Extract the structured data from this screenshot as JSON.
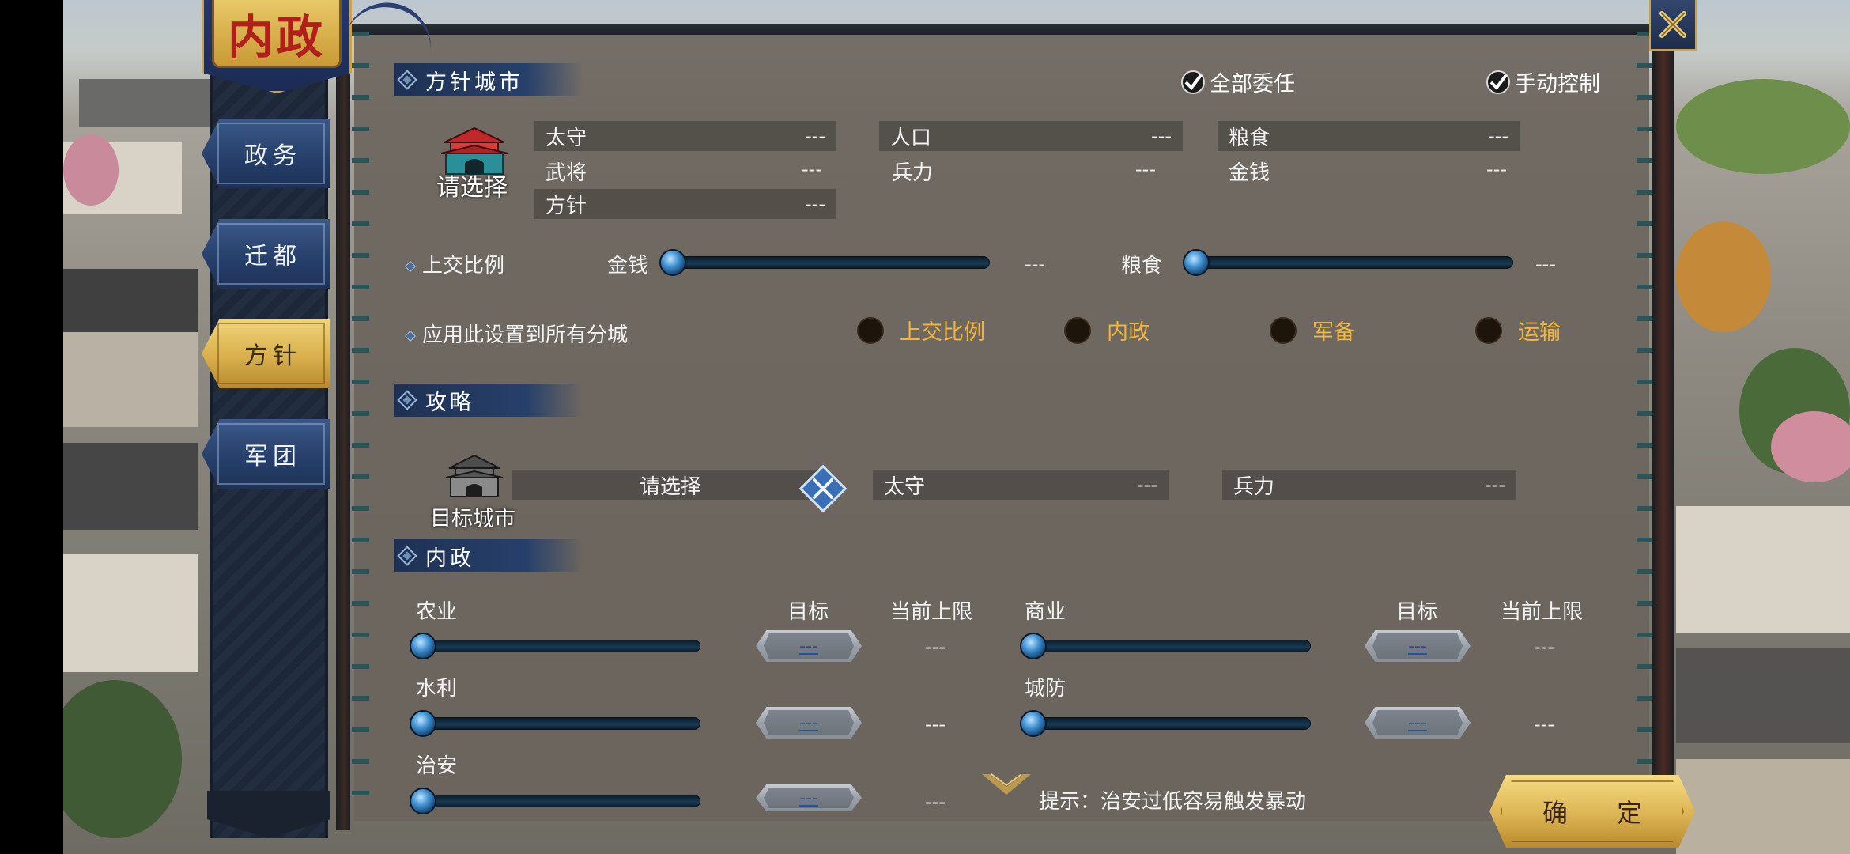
{
  "header": {
    "title": "内政",
    "close_label": ""
  },
  "nav": {
    "items": [
      {
        "label": "政务",
        "active": false
      },
      {
        "label": "迁都",
        "active": false
      },
      {
        "label": "方针",
        "active": true
      },
      {
        "label": "军团",
        "active": false
      }
    ]
  },
  "policy_city": {
    "section_title": "方针城市",
    "delegate_all_label": "全部委任",
    "manual_control_label": "手动控制",
    "city_select_label": "请选择",
    "fields": {
      "governor": {
        "label": "太守",
        "value": "---"
      },
      "general": {
        "label": "武将",
        "value": "---"
      },
      "policy": {
        "label": "方针",
        "value": "---"
      },
      "population": {
        "label": "人口",
        "value": "---"
      },
      "troops": {
        "label": "兵力",
        "value": "---"
      },
      "food": {
        "label": "粮食",
        "value": "---"
      },
      "money": {
        "label": "金钱",
        "value": "---"
      }
    },
    "tribute": {
      "label": "上交比例",
      "money_label": "金钱",
      "money_value": "---",
      "food_label": "粮食",
      "food_value": "---"
    },
    "apply_all": {
      "label": "应用此设置到所有分城",
      "options": [
        "上交比例",
        "内政",
        "军备",
        "运输"
      ]
    }
  },
  "strategy": {
    "section_title": "攻略",
    "target_city_label": "目标城市",
    "select_label": "请选择",
    "governor_label": "太守",
    "governor_value": "---",
    "troops_label": "兵力",
    "troops_value": "---"
  },
  "domestic": {
    "section_title": "内政",
    "target_header": "目标",
    "limit_header": "当前上限",
    "left_items": [
      {
        "label": "农业",
        "target": "---",
        "limit": "---"
      },
      {
        "label": "水利",
        "target": "---",
        "limit": "---"
      },
      {
        "label": "治安",
        "target": "---",
        "limit": "---"
      }
    ],
    "right_items": [
      {
        "label": "商业",
        "target": "---",
        "limit": "---"
      },
      {
        "label": "城防",
        "target": "---",
        "limit": "---"
      }
    ]
  },
  "hint": "提示：治安过低容易触发暴动",
  "confirm_label": "确 定",
  "colors": {
    "accent_gold": "#f2b63a",
    "nav_blue": "#253e69",
    "nav_active_gold": "#d8b04c",
    "panel": "#6a645c"
  }
}
